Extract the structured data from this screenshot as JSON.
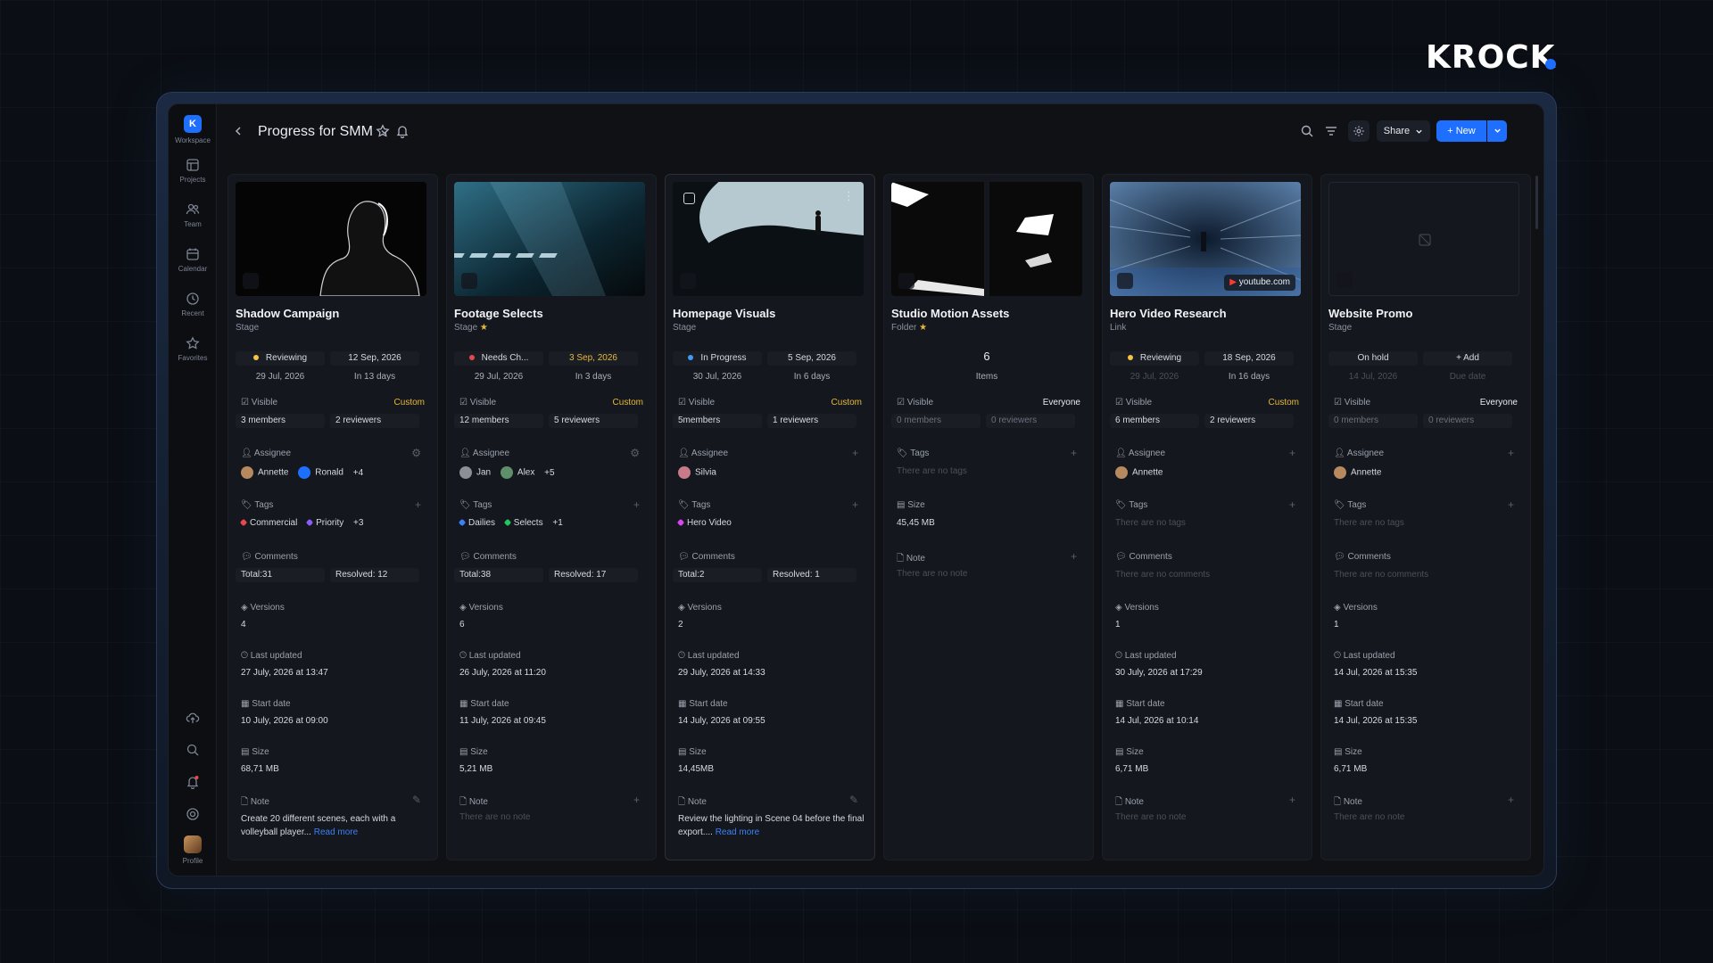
{
  "brand": {
    "name": "KROCK"
  },
  "colors": {
    "accent": "#1f6fff",
    "custom": "#e6b93b",
    "reviewing": "#f5c542",
    "needs": "#e5484d",
    "progress": "#3b9df7"
  },
  "sidebar": {
    "items": [
      {
        "label": "Workspace",
        "icon": "workspace-logo",
        "letter": "K"
      },
      {
        "label": "Projects",
        "icon": "projects-icon"
      },
      {
        "label": "Team",
        "icon": "team-icon"
      },
      {
        "label": "Calendar",
        "icon": "calendar-icon"
      },
      {
        "label": "Recent",
        "icon": "clock-icon"
      },
      {
        "label": "Favorites",
        "icon": "star-icon"
      }
    ],
    "profile_label": "Profile"
  },
  "header": {
    "title": "Progress for SMM",
    "share_label": "Share",
    "new_label": "New"
  },
  "labels": {
    "visible": "Visible",
    "assignee": "Assignee",
    "tags": "Tags",
    "comments": "Comments",
    "versions": "Versions",
    "last_updated": "Last updated",
    "start_date": "Start date",
    "size": "Size",
    "note": "Note",
    "no_tags": "There are no tags",
    "no_comments": "There are no comments",
    "no_note": "There are no note",
    "read_more": "Read more"
  },
  "cards": [
    {
      "name": "Shadow Campaign",
      "type": "Stage",
      "starred": false,
      "status": "Reviewing",
      "status_color": "#f5c542",
      "date1": "12 Sep, 2026",
      "start_sub": "29 Jul, 2026",
      "due_sub": "In 13 days",
      "visibility": "Custom",
      "members": "3 members",
      "reviewers": "2 reviewers",
      "assignees": [
        "Annette",
        "Ronald"
      ],
      "assignee_more": "+4",
      "tags": [
        {
          "name": "Commercial",
          "color": "#e5484d"
        },
        {
          "name": "Priority",
          "color": "#8b5cf6"
        }
      ],
      "tags_more": "+3",
      "comments_total": "Total:31",
      "comments_resolved": "Resolved: 12",
      "versions": "4",
      "last_updated": "27 July, 2026 at 13:47",
      "start_date": "10 July, 2026 at 09:00",
      "size": "68,71 MB",
      "note": "Create 20 different scenes, each with a volleyball player...",
      "has_note": true
    },
    {
      "name": "Footage Selects",
      "type": "Stage",
      "starred": true,
      "status": "Needs Ch...",
      "status_color": "#e5484d",
      "date1": "3 Sep, 2026",
      "start_sub": "29 Jul, 2026",
      "due_sub": "In 3 days",
      "visibility": "Custom",
      "members": "12 members",
      "reviewers": "5 reviewers",
      "assignees": [
        "Jan",
        "Alex"
      ],
      "assignee_more": "+5",
      "tags": [
        {
          "name": "Dailies",
          "color": "#3b82f6"
        },
        {
          "name": "Selects",
          "color": "#22c55e"
        }
      ],
      "tags_more": "+1",
      "comments_total": "Total:38",
      "comments_resolved": "Resolved: 17",
      "versions": "6",
      "last_updated": "26 July, 2026 at 11:20",
      "start_date": "11 July, 2026 at 09:45",
      "size": "5,21 MB",
      "note": "",
      "has_note": false
    },
    {
      "name": "Homepage Visuals",
      "type": "Stage",
      "starred": false,
      "status": "In Progress",
      "status_color": "#3b9df7",
      "date1": "5 Sep, 2026",
      "start_sub": "30 Jul, 2026",
      "due_sub": "In 6 days",
      "visibility": "Custom",
      "members": "5members",
      "reviewers": "1 reviewers",
      "assignees": [
        "Silvia"
      ],
      "assignee_more": "",
      "tags": [
        {
          "name": "Hero Video",
          "color": "#d946ef"
        }
      ],
      "tags_more": "",
      "comments_total": "Total:2",
      "comments_resolved": "Resolved: 1",
      "versions": "2",
      "last_updated": "29 July, 2026 at 14:33",
      "start_date": "14 July, 2026 at 09:55",
      "size": "14,45MB",
      "note": "Review the lighting in Scene 04 before the final export....",
      "has_note": true
    },
    {
      "name": "Studio Motion Assets",
      "type": "Folder",
      "starred": true,
      "items_count": "6",
      "items_label": "Items",
      "visibility": "Everyone",
      "members": "0 members",
      "reviewers": "0 reviewers",
      "size": "45,45 MB"
    },
    {
      "name": "Hero Video Research",
      "type": "Link",
      "starred": false,
      "link_host": "youtube.com",
      "status": "Reviewing",
      "status_color": "#f5c542",
      "date1": "18 Sep, 2026",
      "start_sub": "29 Jul, 2026",
      "due_sub": "In 16 days",
      "visibility": "Custom",
      "members": "6 members",
      "reviewers": "2 reviewers",
      "assignees": [
        "Annette"
      ],
      "assignee_more": "",
      "versions": "1",
      "last_updated": "30 July, 2026 at 17:29",
      "start_date": "14 Jul, 2026 at 10:14",
      "size": "6,71 MB"
    },
    {
      "name": "Website Promo",
      "type": "Stage",
      "starred": false,
      "status": "On hold",
      "add_label": "+ Add",
      "start_sub": "14 Jul, 2026",
      "due_sub": "Due date",
      "visibility": "Everyone",
      "members": "0 members",
      "reviewers": "0 reviewers",
      "assignees": [
        "Annette"
      ],
      "assignee_more": "",
      "versions": "1",
      "last_updated": "14 Jul, 2026 at 15:35",
      "start_date": "14 Jul, 2026 at 15:35",
      "size": "6,71 MB"
    }
  ]
}
